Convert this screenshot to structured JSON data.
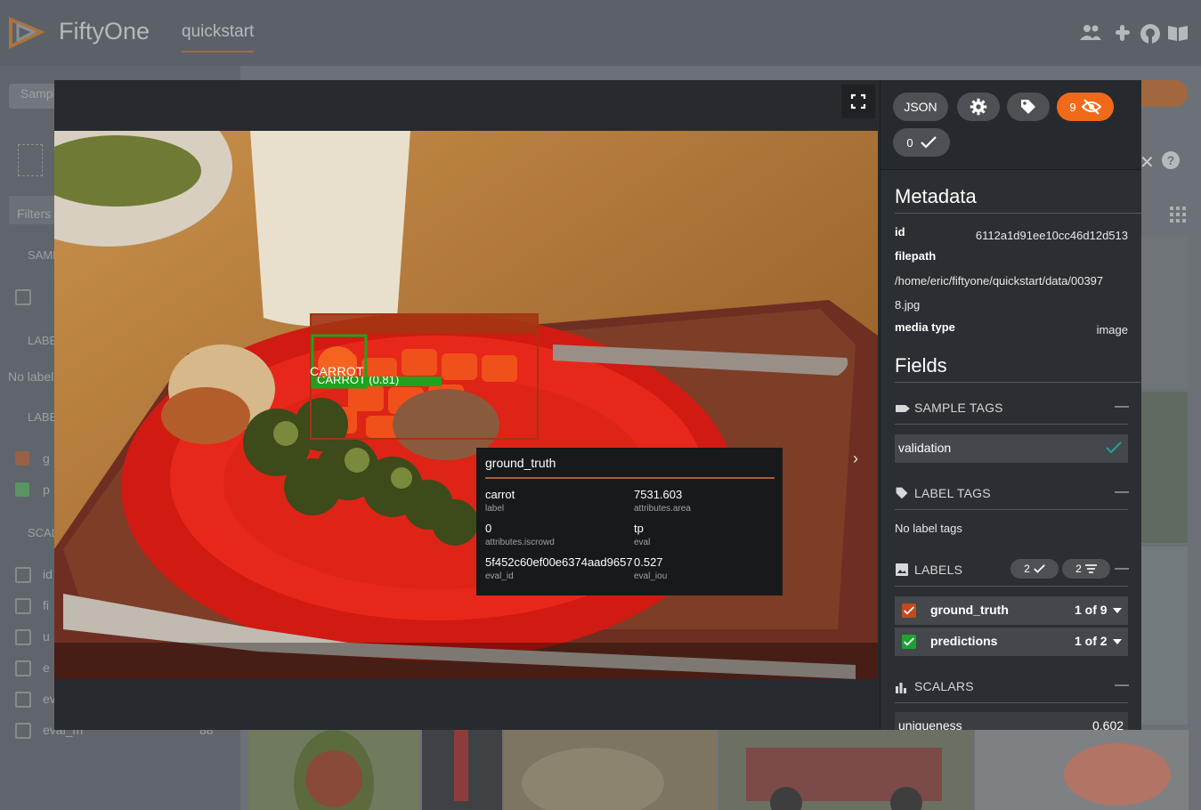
{
  "app": {
    "brand": "FiftyOne",
    "dataset_tab": "quickstart",
    "bg_sidebar": {
      "samples_btn": "Sampl",
      "filters": "Filters",
      "sample_tags": "SAMP",
      "labels_tags": "LABE",
      "no_label": "No label",
      "labels": "LABE",
      "gt_prefix": "g",
      "pred_prefix": "p",
      "scalars": "SCAL",
      "rows": [
        "id",
        "fi",
        "u",
        "e",
        "ev",
        "eval_m"
      ],
      "last_count": "88"
    }
  },
  "modal": {
    "image_alt": "Plate with carrots, broccoli and bread roll",
    "ground_truth_box_label": "CARROT",
    "prediction_box_label": "CARROT (0.81)",
    "tooltip": {
      "title": "ground_truth",
      "fields": [
        {
          "value": "carrot",
          "key": "label"
        },
        {
          "value": "7531.603",
          "key": "attributes.area"
        },
        {
          "value": "0",
          "key": "attributes.iscrowd"
        },
        {
          "value": "tp",
          "key": "eval"
        },
        {
          "value": "5f452c60ef00e6374aad9657",
          "key": "eval_id"
        },
        {
          "value": "0.527",
          "key": "eval_iou"
        }
      ]
    },
    "sidebar": {
      "json_btn": "JSON",
      "hidden_count": "9",
      "selected_count": "0",
      "metadata_title": "Metadata",
      "metadata": {
        "id_key": "id",
        "id_val": "6112a1d91ee10cc46d12d513",
        "filepath_key": "filepath",
        "filepath_line1": "/home/eric/fiftyone/quickstart/data/00397",
        "filepath_line2": "8.jpg",
        "media_type_key": "media type",
        "media_type_val": "image"
      },
      "fields_title": "Fields",
      "sample_tags_header": "SAMPLE TAGS",
      "sample_tag": "validation",
      "label_tags_header": "LABEL TAGS",
      "no_label_tags": "No label tags",
      "labels_header": "LABELS",
      "labels_selected": "2",
      "labels_filtered": "2",
      "label_fields": [
        {
          "name": "ground_truth",
          "count": "1 of 9",
          "color": "#c14b1f"
        },
        {
          "name": "predictions",
          "count": "1 of 2",
          "color": "#1fa232"
        }
      ],
      "scalars_header": "SCALARS",
      "uniqueness_key": "uniqueness",
      "uniqueness_val": "0.602",
      "minus": "—"
    }
  }
}
